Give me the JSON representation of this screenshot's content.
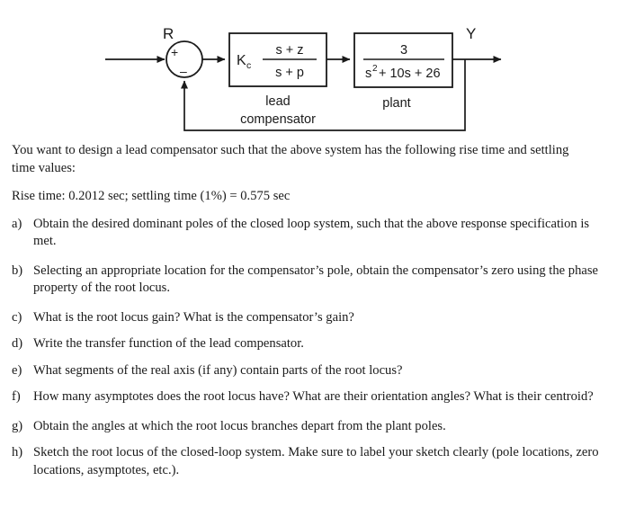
{
  "page": {
    "background_color": "#ffffff",
    "text_color": "#1a1a1a"
  },
  "diagram": {
    "name": "feedback-control-block-diagram",
    "input_label": "R",
    "output_label": "Y",
    "summing_junction": {
      "plus_sign": "+",
      "minus_sign": "–"
    },
    "compensator_block": {
      "gain": "K",
      "gain_subscript": "c",
      "numerator": "s + z",
      "denominator": "s + p",
      "caption_line1": "lead",
      "caption_line2": "compensator"
    },
    "plant_block": {
      "numerator": "3",
      "denominator_s": "s",
      "denominator_exp": "2",
      "denominator_rest": "+ 10s + 26",
      "caption": "plant"
    }
  },
  "content": {
    "intro": "You want to design a lead compensator such that the above system has the following rise time and settling time values:",
    "spec": "Rise time: 0.2012 sec; settling time (1%) = 0.575 sec",
    "items": [
      {
        "marker": "a)",
        "text": "Obtain the desired dominant poles of the closed loop system, such that the above response specification is met."
      },
      {
        "marker": "b)",
        "text": "Selecting an appropriate location for the compensator’s pole, obtain the compensator’s zero using the phase property of the root locus."
      },
      {
        "marker": "c)",
        "text": "What is the root locus gain? What is the compensator’s gain?"
      },
      {
        "marker": "d)",
        "text": "Write the transfer function of the lead compensator."
      },
      {
        "marker": "e)",
        "text": "What segments of the real axis (if any) contain parts of the root locus?"
      },
      {
        "marker": "f)",
        "text": "How many asymptotes does the root locus have? What are their orientation angles? What is their centroid?"
      },
      {
        "marker": "g)",
        "text": "Obtain the angles at which the root locus branches depart from the plant poles."
      },
      {
        "marker": "h)",
        "text": "Sketch the root locus of the closed-loop system. Make sure to label your sketch clearly (pole locations, zero locations, asymptotes, etc.)."
      }
    ]
  }
}
